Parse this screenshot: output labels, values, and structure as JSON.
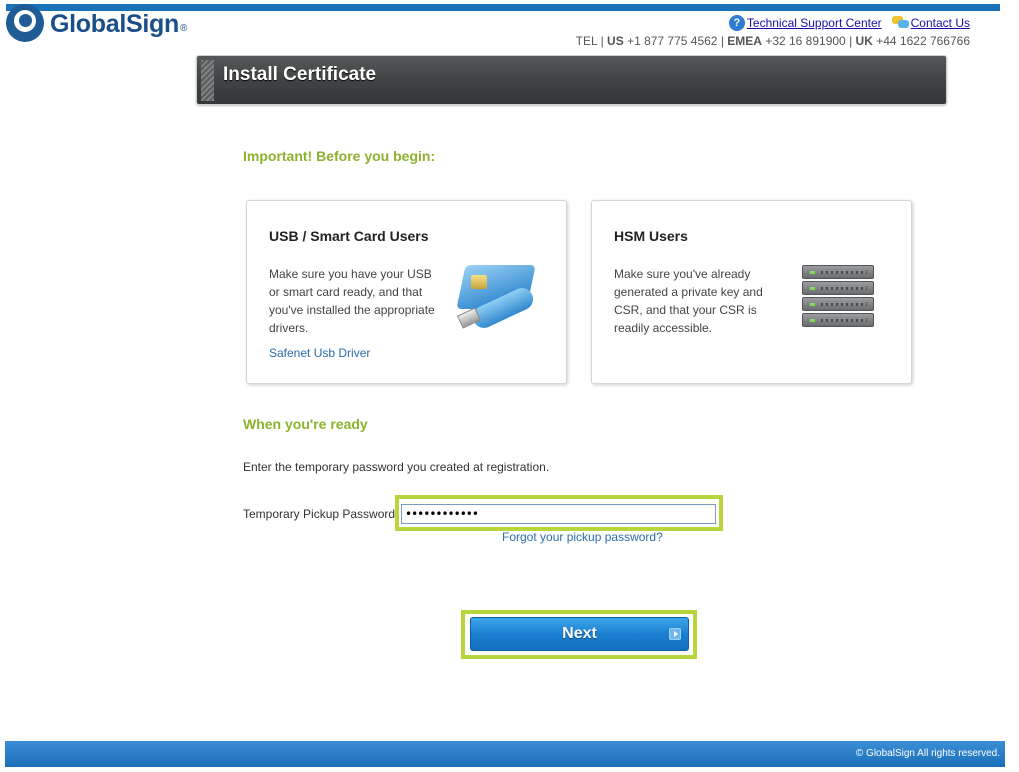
{
  "brand": {
    "name": "GlobalSign",
    "registered_mark": "®",
    "logo_icon": "globalsign-eye-logo"
  },
  "header": {
    "support_link": "Technical Support Center",
    "contact_link": "Contact Us",
    "support_icon": "help-question-icon",
    "contact_icon": "chat-bubbles-icon",
    "phones": {
      "tel_label": "TEL",
      "us_label": "US",
      "us_number": "+1 877 775 4562",
      "emea_label": "EMEA",
      "emea_number": "+32 16 891900",
      "uk_label": "UK",
      "uk_number": "+44 1622 766766",
      "separator": "|"
    }
  },
  "page": {
    "title": "Install Certificate"
  },
  "before_begin": {
    "heading": "Important! Before you begin:",
    "cards": [
      {
        "title": "USB / Smart Card Users",
        "description": "Make sure you have your USB or smart card ready, and that you've installed the appropriate drivers.",
        "link": "Safenet Usb Driver",
        "icon": "usb-smart-card-icon"
      },
      {
        "title": "HSM Users",
        "description": "Make sure you've already generated a private key and CSR, and that your CSR is readily accessible.",
        "icon": "hsm-server-icon"
      }
    ]
  },
  "ready": {
    "heading": "When you're ready",
    "instructions": "Enter the temporary password you created at registration.",
    "password_label": "Temporary Pickup Password",
    "password_value": "••••••••••••",
    "forgot_link": "Forgot your pickup password?",
    "next_label": "Next"
  },
  "footer": {
    "copyright": "© GlobalSign All rights reserved."
  },
  "colors": {
    "brand_blue": "#1a4f8a",
    "accent_green": "#8cb32d",
    "highlight_green": "#b7d63c",
    "button_blue": "#1a7fd0",
    "title_bar_dark": "#3f4243"
  }
}
